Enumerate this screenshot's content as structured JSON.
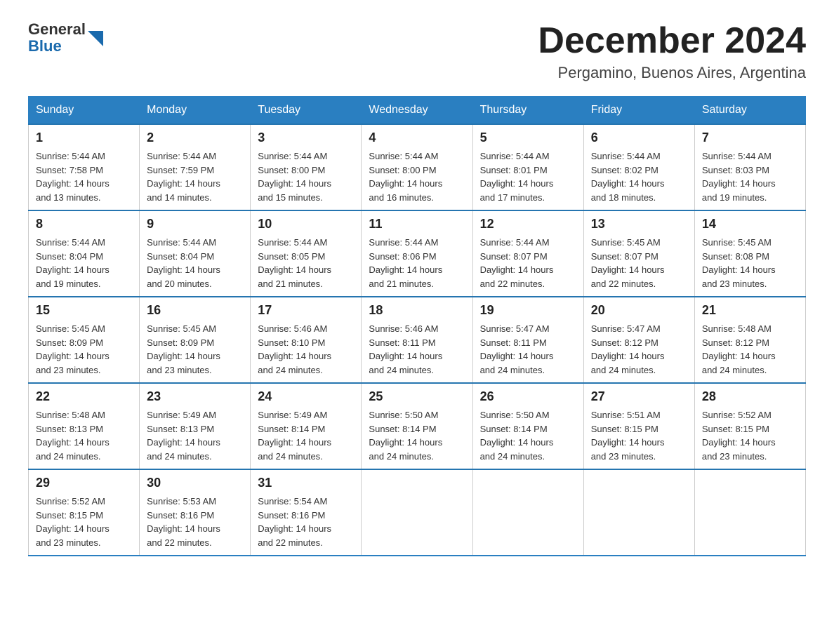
{
  "header": {
    "logo": {
      "general": "General",
      "blue": "Blue"
    },
    "title": "December 2024",
    "location": "Pergamino, Buenos Aires, Argentina"
  },
  "weekdays": [
    "Sunday",
    "Monday",
    "Tuesday",
    "Wednesday",
    "Thursday",
    "Friday",
    "Saturday"
  ],
  "weeks": [
    [
      {
        "day": "1",
        "sunrise": "5:44 AM",
        "sunset": "7:58 PM",
        "daylight": "14 hours and 13 minutes."
      },
      {
        "day": "2",
        "sunrise": "5:44 AM",
        "sunset": "7:59 PM",
        "daylight": "14 hours and 14 minutes."
      },
      {
        "day": "3",
        "sunrise": "5:44 AM",
        "sunset": "8:00 PM",
        "daylight": "14 hours and 15 minutes."
      },
      {
        "day": "4",
        "sunrise": "5:44 AM",
        "sunset": "8:00 PM",
        "daylight": "14 hours and 16 minutes."
      },
      {
        "day": "5",
        "sunrise": "5:44 AM",
        "sunset": "8:01 PM",
        "daylight": "14 hours and 17 minutes."
      },
      {
        "day": "6",
        "sunrise": "5:44 AM",
        "sunset": "8:02 PM",
        "daylight": "14 hours and 18 minutes."
      },
      {
        "day": "7",
        "sunrise": "5:44 AM",
        "sunset": "8:03 PM",
        "daylight": "14 hours and 19 minutes."
      }
    ],
    [
      {
        "day": "8",
        "sunrise": "5:44 AM",
        "sunset": "8:04 PM",
        "daylight": "14 hours and 19 minutes."
      },
      {
        "day": "9",
        "sunrise": "5:44 AM",
        "sunset": "8:04 PM",
        "daylight": "14 hours and 20 minutes."
      },
      {
        "day": "10",
        "sunrise": "5:44 AM",
        "sunset": "8:05 PM",
        "daylight": "14 hours and 21 minutes."
      },
      {
        "day": "11",
        "sunrise": "5:44 AM",
        "sunset": "8:06 PM",
        "daylight": "14 hours and 21 minutes."
      },
      {
        "day": "12",
        "sunrise": "5:44 AM",
        "sunset": "8:07 PM",
        "daylight": "14 hours and 22 minutes."
      },
      {
        "day": "13",
        "sunrise": "5:45 AM",
        "sunset": "8:07 PM",
        "daylight": "14 hours and 22 minutes."
      },
      {
        "day": "14",
        "sunrise": "5:45 AM",
        "sunset": "8:08 PM",
        "daylight": "14 hours and 23 minutes."
      }
    ],
    [
      {
        "day": "15",
        "sunrise": "5:45 AM",
        "sunset": "8:09 PM",
        "daylight": "14 hours and 23 minutes."
      },
      {
        "day": "16",
        "sunrise": "5:45 AM",
        "sunset": "8:09 PM",
        "daylight": "14 hours and 23 minutes."
      },
      {
        "day": "17",
        "sunrise": "5:46 AM",
        "sunset": "8:10 PM",
        "daylight": "14 hours and 24 minutes."
      },
      {
        "day": "18",
        "sunrise": "5:46 AM",
        "sunset": "8:11 PM",
        "daylight": "14 hours and 24 minutes."
      },
      {
        "day": "19",
        "sunrise": "5:47 AM",
        "sunset": "8:11 PM",
        "daylight": "14 hours and 24 minutes."
      },
      {
        "day": "20",
        "sunrise": "5:47 AM",
        "sunset": "8:12 PM",
        "daylight": "14 hours and 24 minutes."
      },
      {
        "day": "21",
        "sunrise": "5:48 AM",
        "sunset": "8:12 PM",
        "daylight": "14 hours and 24 minutes."
      }
    ],
    [
      {
        "day": "22",
        "sunrise": "5:48 AM",
        "sunset": "8:13 PM",
        "daylight": "14 hours and 24 minutes."
      },
      {
        "day": "23",
        "sunrise": "5:49 AM",
        "sunset": "8:13 PM",
        "daylight": "14 hours and 24 minutes."
      },
      {
        "day": "24",
        "sunrise": "5:49 AM",
        "sunset": "8:14 PM",
        "daylight": "14 hours and 24 minutes."
      },
      {
        "day": "25",
        "sunrise": "5:50 AM",
        "sunset": "8:14 PM",
        "daylight": "14 hours and 24 minutes."
      },
      {
        "day": "26",
        "sunrise": "5:50 AM",
        "sunset": "8:14 PM",
        "daylight": "14 hours and 24 minutes."
      },
      {
        "day": "27",
        "sunrise": "5:51 AM",
        "sunset": "8:15 PM",
        "daylight": "14 hours and 23 minutes."
      },
      {
        "day": "28",
        "sunrise": "5:52 AM",
        "sunset": "8:15 PM",
        "daylight": "14 hours and 23 minutes."
      }
    ],
    [
      {
        "day": "29",
        "sunrise": "5:52 AM",
        "sunset": "8:15 PM",
        "daylight": "14 hours and 23 minutes."
      },
      {
        "day": "30",
        "sunrise": "5:53 AM",
        "sunset": "8:16 PM",
        "daylight": "14 hours and 22 minutes."
      },
      {
        "day": "31",
        "sunrise": "5:54 AM",
        "sunset": "8:16 PM",
        "daylight": "14 hours and 22 minutes."
      },
      null,
      null,
      null,
      null
    ]
  ],
  "labels": {
    "sunrise": "Sunrise:",
    "sunset": "Sunset:",
    "daylight": "Daylight:"
  }
}
